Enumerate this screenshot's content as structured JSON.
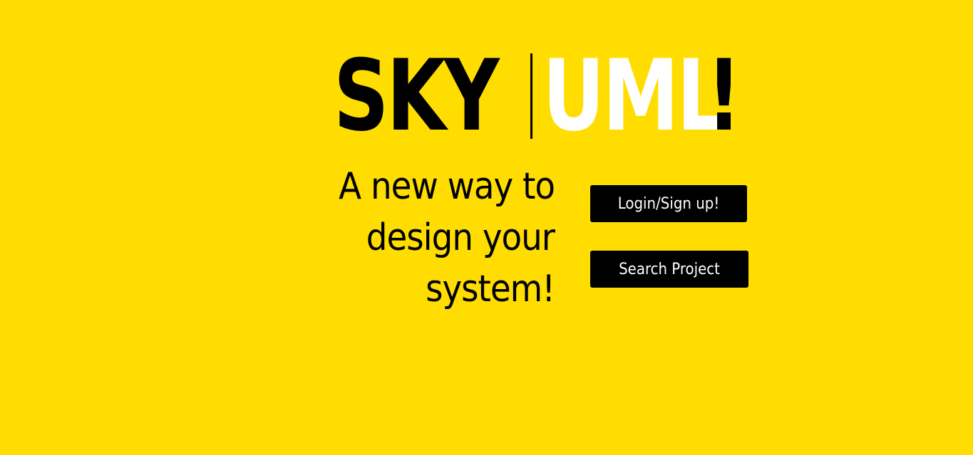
{
  "brand": {
    "sky": "SKY",
    "uml": "UML",
    "bang": "!"
  },
  "tagline": {
    "line1": "A new way to",
    "line2": "design your",
    "line3": "system!"
  },
  "buttons": {
    "login": "Login/Sign up!",
    "search": "Search Project"
  },
  "colors": {
    "background": "#FFDD00",
    "text": "#000000",
    "accent": "#FFFFFF"
  }
}
